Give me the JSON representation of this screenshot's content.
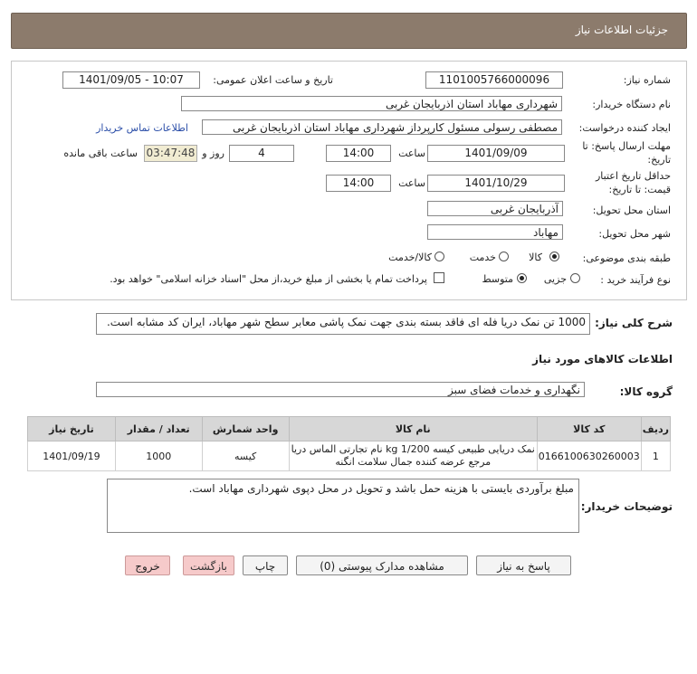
{
  "header": {
    "title": "جزئیات اطلاعات نیاز"
  },
  "fields": {
    "need_number_label": "شماره نیاز:",
    "need_number": "1101005766000096",
    "announce_label": "تاریخ و ساعت اعلان عمومی:",
    "announce_value": "1401/09/05 - 10:07",
    "buyer_org_label": "نام دستگاه خریدار:",
    "buyer_org": "شهرداری مهاباد استان اذربایجان غربی",
    "creator_label": "ایجاد کننده درخواست:",
    "creator": "مصطفی رسولی مسئول کارپرداز  شهرداری مهاباد استان اذربایجان غربی",
    "contact_link": "اطلاعات تماس خریدار",
    "deadline_label_1": "مهلت ارسال پاسخ: تا",
    "deadline_label_2": "تاریخ:",
    "deadline_date": "1401/09/09",
    "time_label": "ساعت",
    "deadline_time": "14:00",
    "days_value": "4",
    "days_label": "روز و",
    "remaining_time": "03:47:48",
    "remaining_label": "ساعت باقی مانده",
    "validity_label_1": "حداقل تاریخ اعتبار",
    "validity_label_2": "قیمت: تا تاریخ:",
    "validity_date": "1401/10/29",
    "validity_time": "14:00",
    "province_label": "استان محل تحویل:",
    "province": "آذربایجان غربی",
    "city_label": "شهر محل تحویل:",
    "city": "مهاباد",
    "category_label": "طبقه بندی موضوعی:",
    "category_options": [
      "کالا",
      "خدمت",
      "کالا/خدمت"
    ],
    "process_label": "نوع فرآیند خرید :",
    "process_options": [
      "جزیی",
      "متوسط"
    ],
    "payment_note": "پرداخت تمام یا بخشی از مبلغ خرید،از محل \"اسناد خزانه اسلامی\" خواهد بود."
  },
  "summary": {
    "label": "شرح کلی نیاز:",
    "text": "1000 تن نمک دریا فله ای فاقد بسته بندی جهت نمک پاشی معابر سطح شهر مهاباد، ایران کد مشابه است."
  },
  "goods": {
    "section_title": "اطلاعات کالاهای مورد نیاز",
    "group_label": "گروه کالا:",
    "group_value": "نگهداری و خدمات فضای سبز",
    "columns": [
      "ردیف",
      "کد کالا",
      "نام کالا",
      "واحد شمارش",
      "تعداد / مقدار",
      "تاریخ نیاز"
    ],
    "rows": [
      {
        "idx": "1",
        "code": "0166100630260003",
        "name_1": "نمک دریایی طبیعی کیسه 1/200 kg نام تجارتی الماس دریا",
        "name_2": "مرجع عرضه کننده جمال سلامت انگنه",
        "unit": "کیسه",
        "qty": "1000",
        "date": "1401/09/19"
      }
    ]
  },
  "buyer_notes": {
    "label": "توضیحات خریدار:",
    "text": "مبلغ برآوردی بایستی با هزینه حمل باشد و تحویل در محل دپوی شهرداری مهاباد است."
  },
  "buttons": {
    "reply": "پاسخ به نیاز",
    "attachments": "مشاهده مدارک پیوستی (0)",
    "print": "چاپ",
    "back": "بازگشت",
    "exit": "خروج"
  }
}
